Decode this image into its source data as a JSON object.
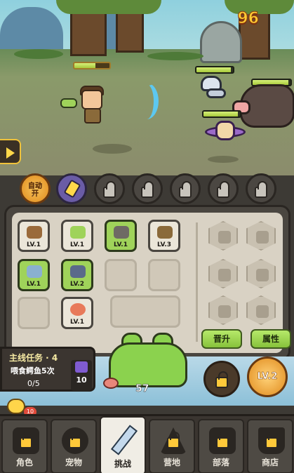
{
  "hud": {
    "gold_count": "96"
  },
  "skills": {
    "auto_label": "自动\n开"
  },
  "inventory": {
    "items": [
      {
        "level": "LV.1"
      },
      {
        "level": "LV.1"
      },
      {
        "level": "LV.1"
      },
      {
        "level": "LV.3"
      },
      {
        "level": "LV.1"
      },
      {
        "level": "LV.2"
      },
      {
        "level": "LV.1"
      }
    ],
    "promote_label": "晋升",
    "attributes_label": "属性"
  },
  "mission": {
    "title": "主线任务 · 4",
    "description": "喂食鳄鱼5次",
    "progress": "0/5",
    "reward_count": "10"
  },
  "pet": {
    "feed_count": "57"
  },
  "level_button": "LV.2",
  "chat": {
    "badge": "10"
  },
  "nav": {
    "items": [
      {
        "label": "角色"
      },
      {
        "label": "宠物"
      },
      {
        "label": "挑战"
      },
      {
        "label": "营地"
      },
      {
        "label": "部落"
      },
      {
        "label": "商店"
      }
    ]
  },
  "colors": {
    "accent": "#9fd35a",
    "gold": "#ffcc33",
    "panel": "#d9d2c4"
  }
}
